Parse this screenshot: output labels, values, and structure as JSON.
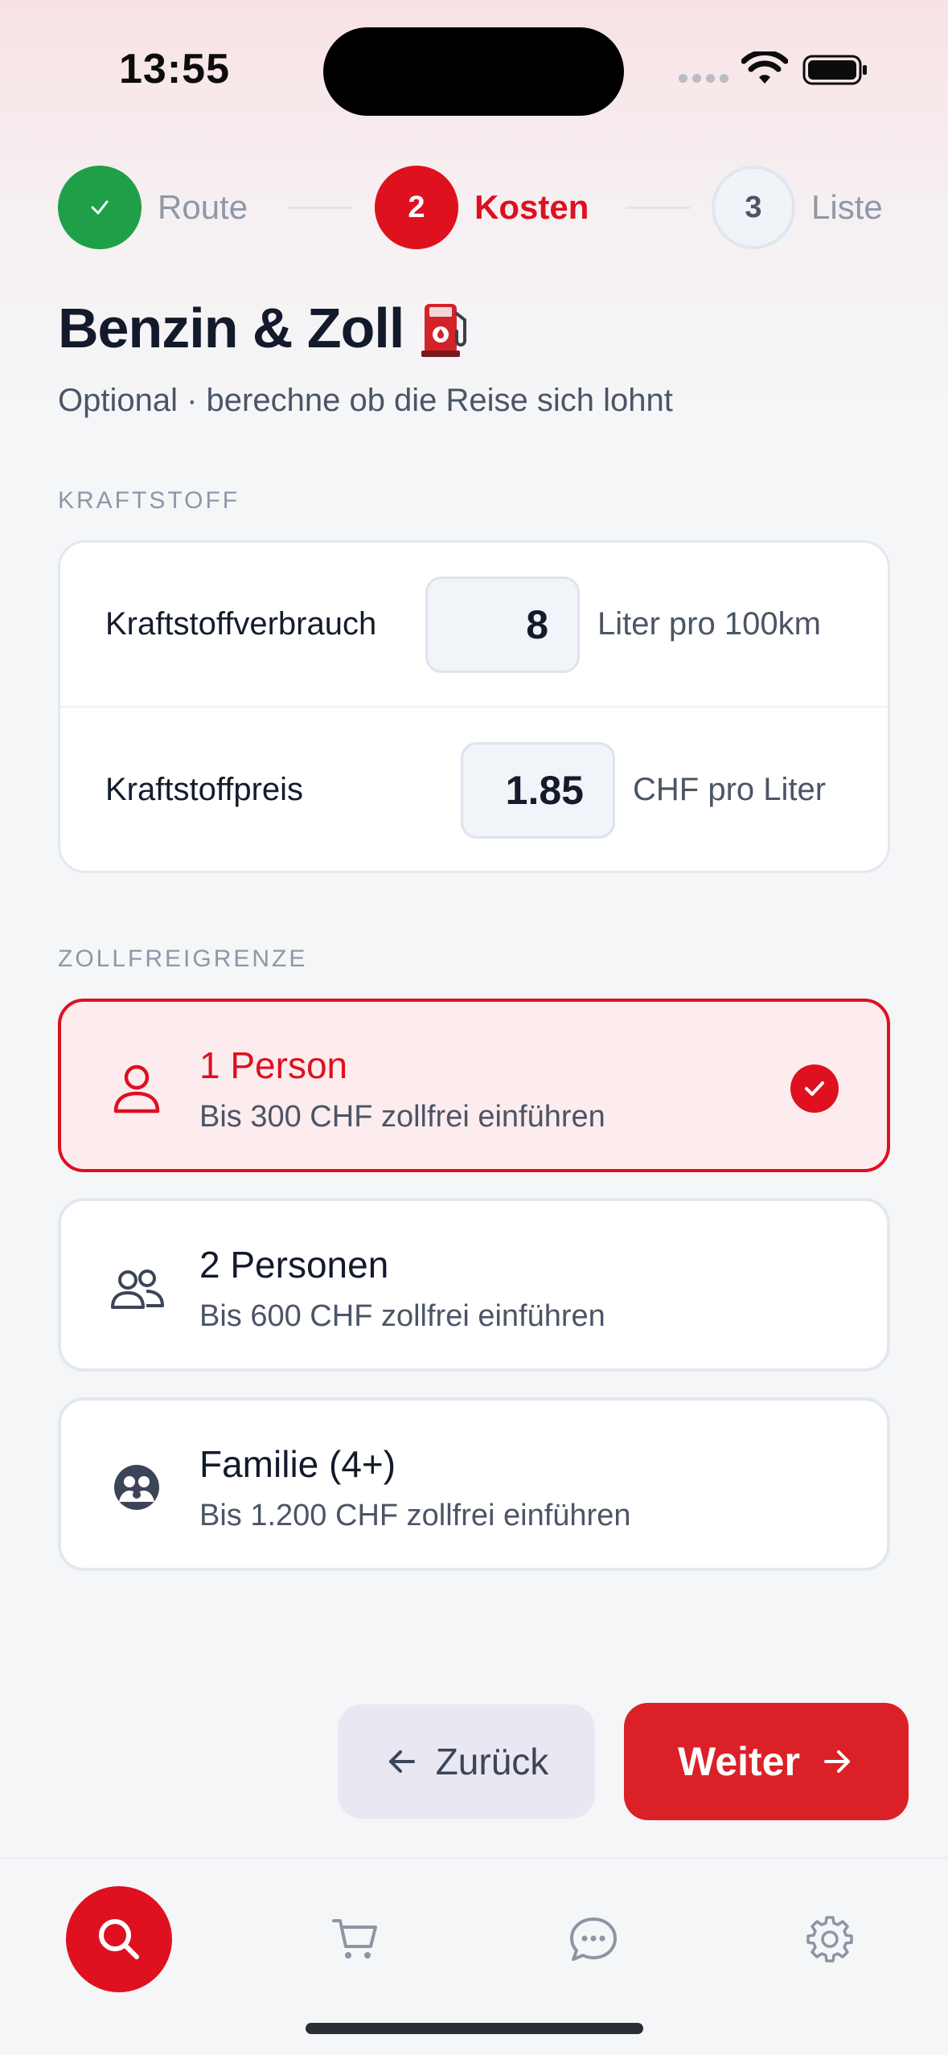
{
  "status_bar": {
    "time": "13:55"
  },
  "stepper": {
    "steps": [
      {
        "number": "✓",
        "label": "Route",
        "state": "done"
      },
      {
        "number": "2",
        "label": "Kosten",
        "state": "active"
      },
      {
        "number": "3",
        "label": "Liste",
        "state": "todo"
      }
    ]
  },
  "header": {
    "title": "Benzin & Zoll",
    "subtitle": "Optional · berechne ob die Reise sich lohnt"
  },
  "fuel_section": {
    "label": "KRAFTSTOFF",
    "consumption": {
      "label": "Kraftstoffverbrauch",
      "value": "8",
      "unit": "Liter pro 100km"
    },
    "price": {
      "label": "Kraftstoffpreis",
      "value": "1.85",
      "unit": "CHF pro Liter"
    }
  },
  "duty_section": {
    "label": "ZOLLFREIGRENZE",
    "options": [
      {
        "title": "1 Person",
        "subtitle": "Bis 300 CHF zollfrei einführen",
        "icon": "person-icon",
        "selected": true
      },
      {
        "title": "2 Personen",
        "subtitle": "Bis 600 CHF zollfrei einführen",
        "icon": "two-persons-icon",
        "selected": false
      },
      {
        "title": "Familie (4+)",
        "subtitle": "Bis 1.200 CHF zollfrei einführen",
        "icon": "family-icon",
        "selected": false
      }
    ]
  },
  "actions": {
    "back_label": "Zurück",
    "next_label": "Weiter"
  },
  "tab_bar": {
    "tabs": [
      {
        "icon": "search-icon",
        "active": true
      },
      {
        "icon": "cart-icon",
        "active": false
      },
      {
        "icon": "chat-icon",
        "active": false
      },
      {
        "icon": "gear-icon",
        "active": false
      }
    ]
  },
  "colors": {
    "accent": "#e0111f",
    "success": "#1fa048",
    "selected_bg": "#fdecee",
    "background": "#f5f6f8"
  }
}
